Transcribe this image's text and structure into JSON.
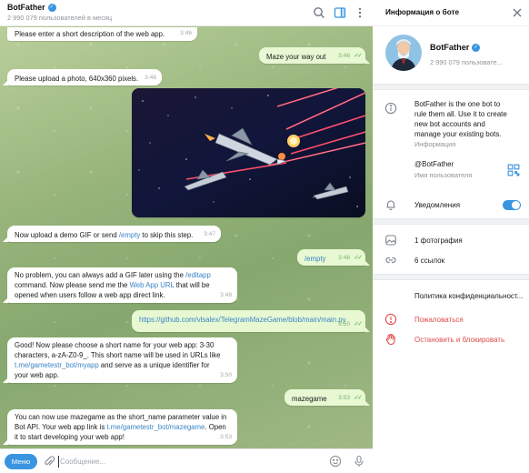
{
  "chat": {
    "title": "BotFather",
    "subtitle": "2 990 079 пользователей в месяц",
    "messages": {
      "m1": {
        "text": "Please enter a short description of the web app.",
        "time": "3:46"
      },
      "m2": {
        "text": "Maze your way out",
        "time": "3:46"
      },
      "m3": {
        "text": "Please upload a photo, 640x360 pixels.",
        "time": "3:46"
      },
      "m4": {
        "pre": "Now upload a demo GIF or send ",
        "link": "/empty",
        "post": " to skip this step.",
        "time": "3:47"
      },
      "m5": {
        "text": "/empty",
        "time": "3:48"
      },
      "m6": {
        "l1a": "No problem, you can always add a GIF later using the ",
        "l1link": "/editapp",
        "l2a": "command. Now please send me the ",
        "l2link": "Web App URL",
        "l2b": " that will be",
        "l3": "opened when users follow a web app direct link.",
        "time": "3:48"
      },
      "m7": {
        "text": "https://github.com/vlsalex/TelegramMazeGame/blob/main/main.py",
        "time": "3:50"
      },
      "m8": {
        "l1": "Good! Now please choose a short name for your web app: 3-30",
        "l2": "characters, a-zA-Z0-9_. This short name will be used in URLs like",
        "l3link": "t.me/gametestr_bot/myapp",
        "l3b": " and serve as a unique identifier for",
        "l4": "your web app.",
        "time": "3:50"
      },
      "m9": {
        "text": "mazegame",
        "time": "3:53"
      },
      "m10": {
        "l1": "You can now use mazegame as the short_name parameter value in",
        "l2a": "Bot API. Your web app link is ",
        "l2link": "t.me/gametestr_bot/mazegame",
        "l2b": ". Open",
        "l3": "it to start developing your web app!",
        "time": "3:53"
      }
    },
    "image_caption": "Spaceships flying through space with laser beams"
  },
  "composer": {
    "menu_label": "Меню",
    "placeholder": "Сообщение..."
  },
  "info": {
    "title": "Информация о боте",
    "name": "BotFather",
    "subscribers": "2 990 079 пользовате...",
    "about": {
      "lines": [
        "BotFather is the one bot to",
        "rule them all. Use it to create",
        "new bot accounts and",
        "manage your existing bots."
      ],
      "label": "Информация"
    },
    "username": {
      "value": "@BotFather",
      "label": "Имя пользователя"
    },
    "notifications": {
      "label": "Уведомления",
      "enabled": true
    },
    "photos": "1 фотография",
    "links": "6 ссылок",
    "privacy": "Политика конфиденциальност...",
    "report": "Пожаловаться",
    "block": "Остановить и блокировать"
  },
  "colors": {
    "accent": "#3a95e0",
    "outgoing": "#e7f8d3",
    "danger": "#e04b4b"
  }
}
